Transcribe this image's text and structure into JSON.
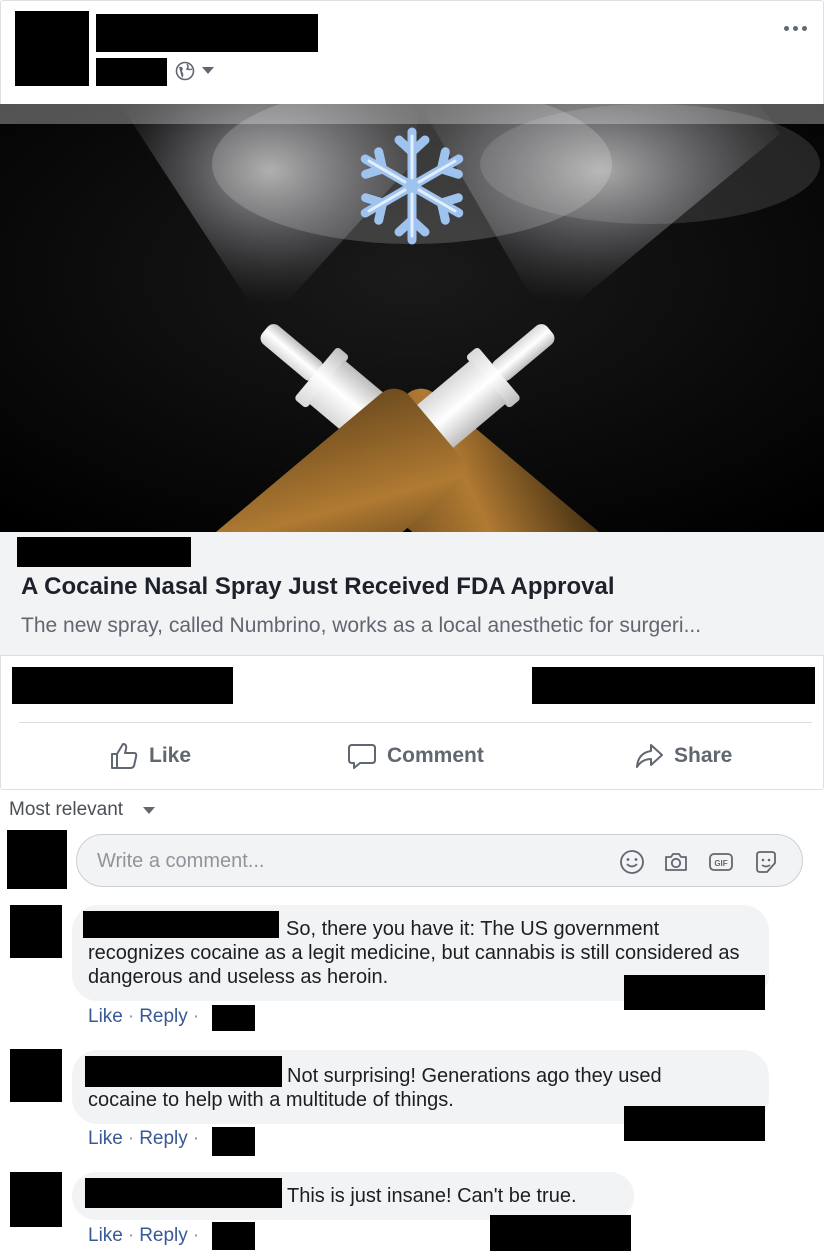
{
  "post": {
    "more_icon": "more-horizontal-icon",
    "audience_icon": "globe-icon",
    "link": {
      "title": "A Cocaine Nasal Spray Just Received FDA Approval",
      "description": "The new spray, called Numbrino, works as a local anesthetic for surgeri..."
    },
    "actions": [
      {
        "label": "Like",
        "icon": "thumbs-up-icon"
      },
      {
        "label": "Comment",
        "icon": "speech-bubble-icon"
      },
      {
        "label": "Share",
        "icon": "share-arrow-icon"
      }
    ]
  },
  "comments_section": {
    "sort_label": "Most relevant",
    "input_placeholder": "Write a comment...",
    "input_icons": [
      "emoji-icon",
      "camera-icon",
      "gif-icon",
      "sticker-icon"
    ],
    "comments": [
      {
        "text_line1": "So, there you have it: The US government",
        "text_rest": "recognizes cocaine as a legit medicine, but cannabis is still considered as dangerous and useless as heroin.",
        "like": "Like",
        "reply": "Reply"
      },
      {
        "text_line1": "Not surprising! Generations ago they used",
        "text_rest": "cocaine to help with a multitude of things.",
        "like": "Like",
        "reply": "Reply"
      },
      {
        "text_line1": "This is just insane! Can't be true.",
        "text_rest": "",
        "like": "Like",
        "reply": "Reply"
      }
    ]
  },
  "colors": {
    "link_blue": "#385898",
    "secondary_text": "#606770",
    "bubble_bg": "#f2f3f5"
  }
}
